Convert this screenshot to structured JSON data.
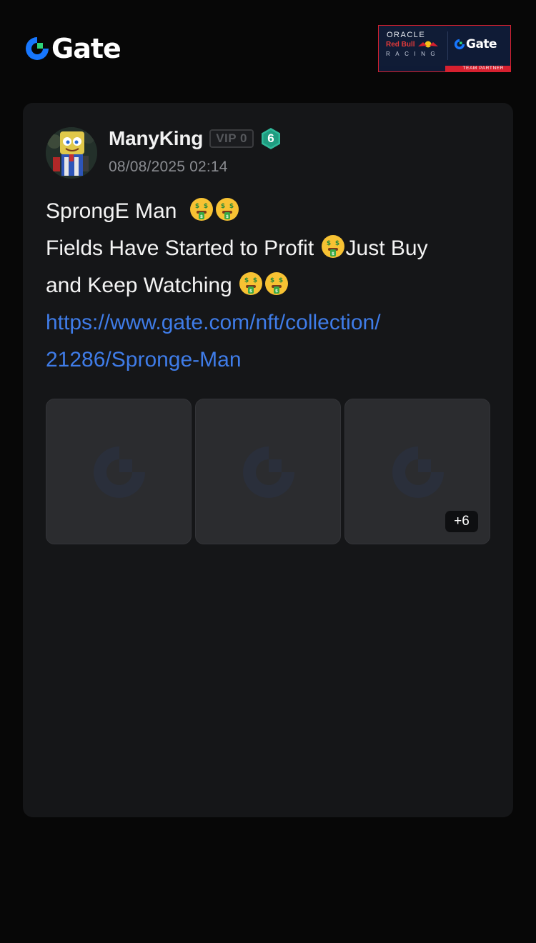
{
  "header": {
    "logo_text": "Gate",
    "partner_badge": {
      "oracle": "ORACLE",
      "redbull": "Red Bull",
      "racing": "RACING",
      "gate": "Gate",
      "team_partner": "TEAM PARTNER"
    }
  },
  "post": {
    "author": {
      "name": "ManyKing",
      "vip": "VIP 0",
      "level": "6"
    },
    "timestamp": "08/08/2025 02:14",
    "lines": [
      "SprongE Man",
      "Fields Have Started to Profit",
      "Just Buy",
      "and Keep Watching"
    ],
    "link_lines": [
      "https://www.gate.com/nft/collection/",
      "21286/Sprongе-Man"
    ],
    "emoji": "money-mouth-face",
    "thumbnails_more": "+6"
  },
  "colors": {
    "background": "#070707",
    "card": "#151618",
    "link": "#3f7ce8",
    "brand_blue": "#1777ff",
    "brand_green": "#2ed47a",
    "level_teal": "#2fb99a"
  }
}
